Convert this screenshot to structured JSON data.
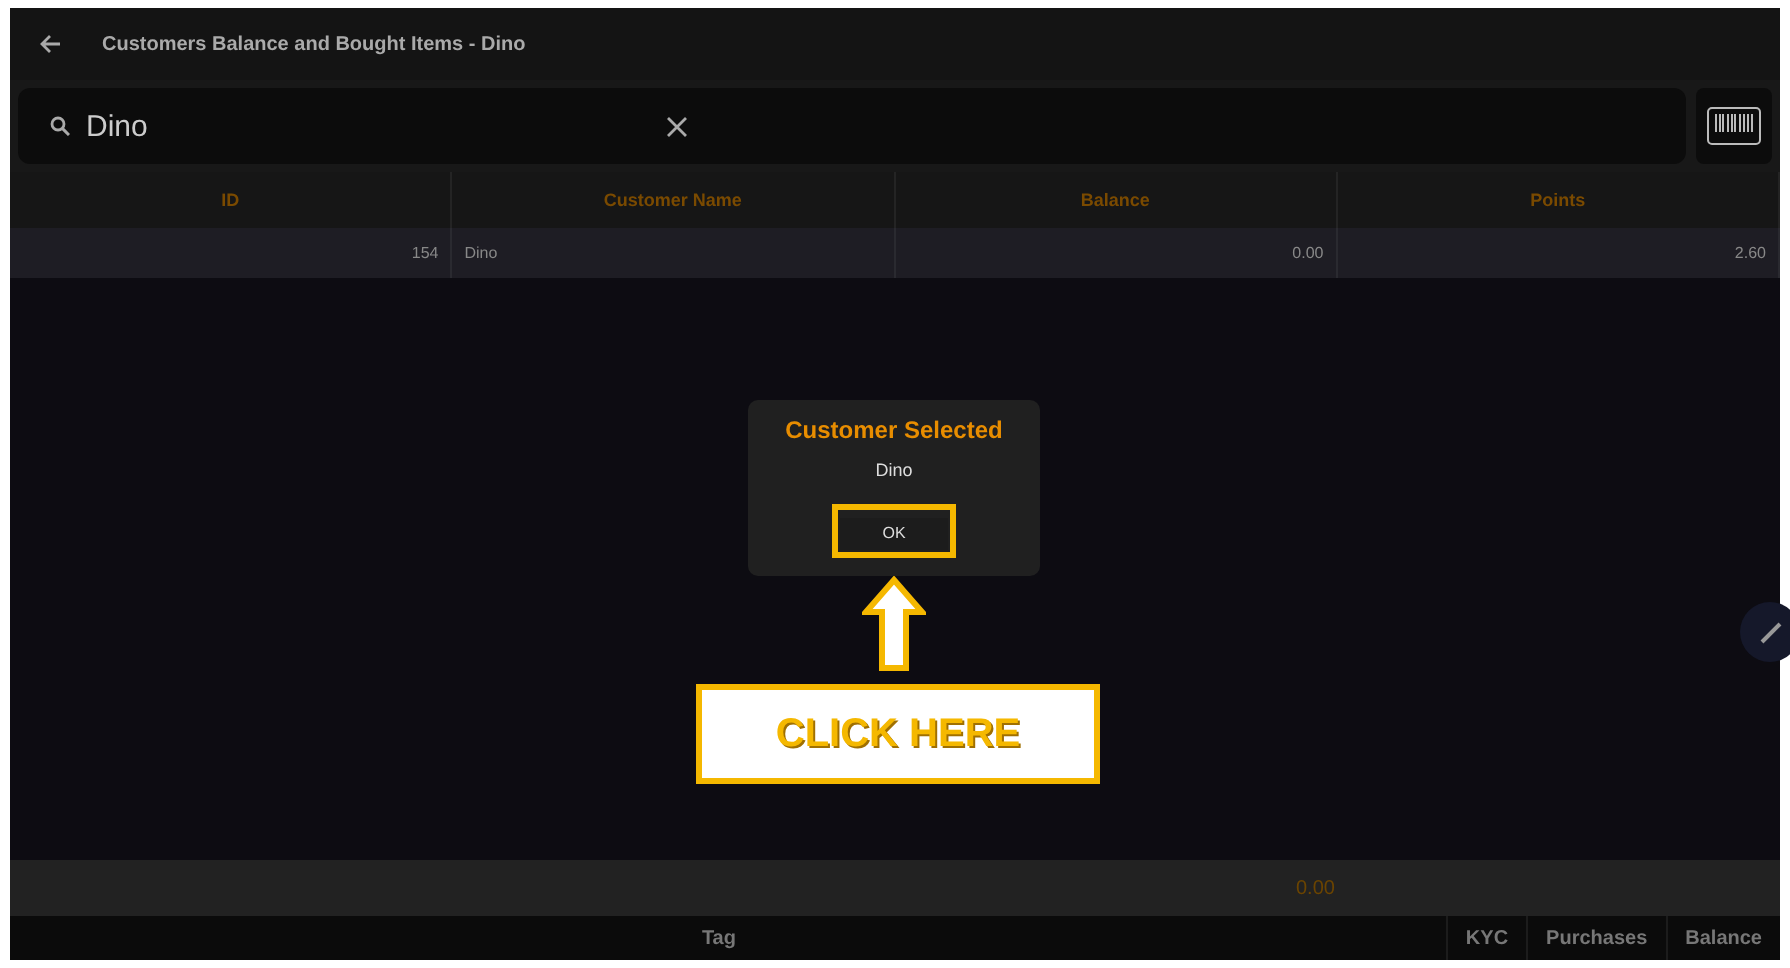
{
  "window": {
    "title": "Customers Balance and Bought Items - Dino"
  },
  "search": {
    "value": "Dino"
  },
  "table": {
    "columns": [
      "ID",
      "Customer Name",
      "Balance",
      "Points"
    ],
    "rows": [
      {
        "cells": [
          "154",
          "Dino",
          "0.00",
          "2.60"
        ],
        "selected": true
      }
    ]
  },
  "totals": {
    "balance": "0.00"
  },
  "bottom_tabs": [
    {
      "label": "Tag",
      "selected": false
    },
    {
      "label": "KYC",
      "selected": false
    },
    {
      "label": "Purchases",
      "selected": false
    },
    {
      "label": "Balance",
      "selected": false
    }
  ],
  "dialog": {
    "title": "Customer Selected",
    "message": "Dino",
    "button": "OK"
  },
  "annotation": {
    "label": "CLICK HERE"
  }
}
